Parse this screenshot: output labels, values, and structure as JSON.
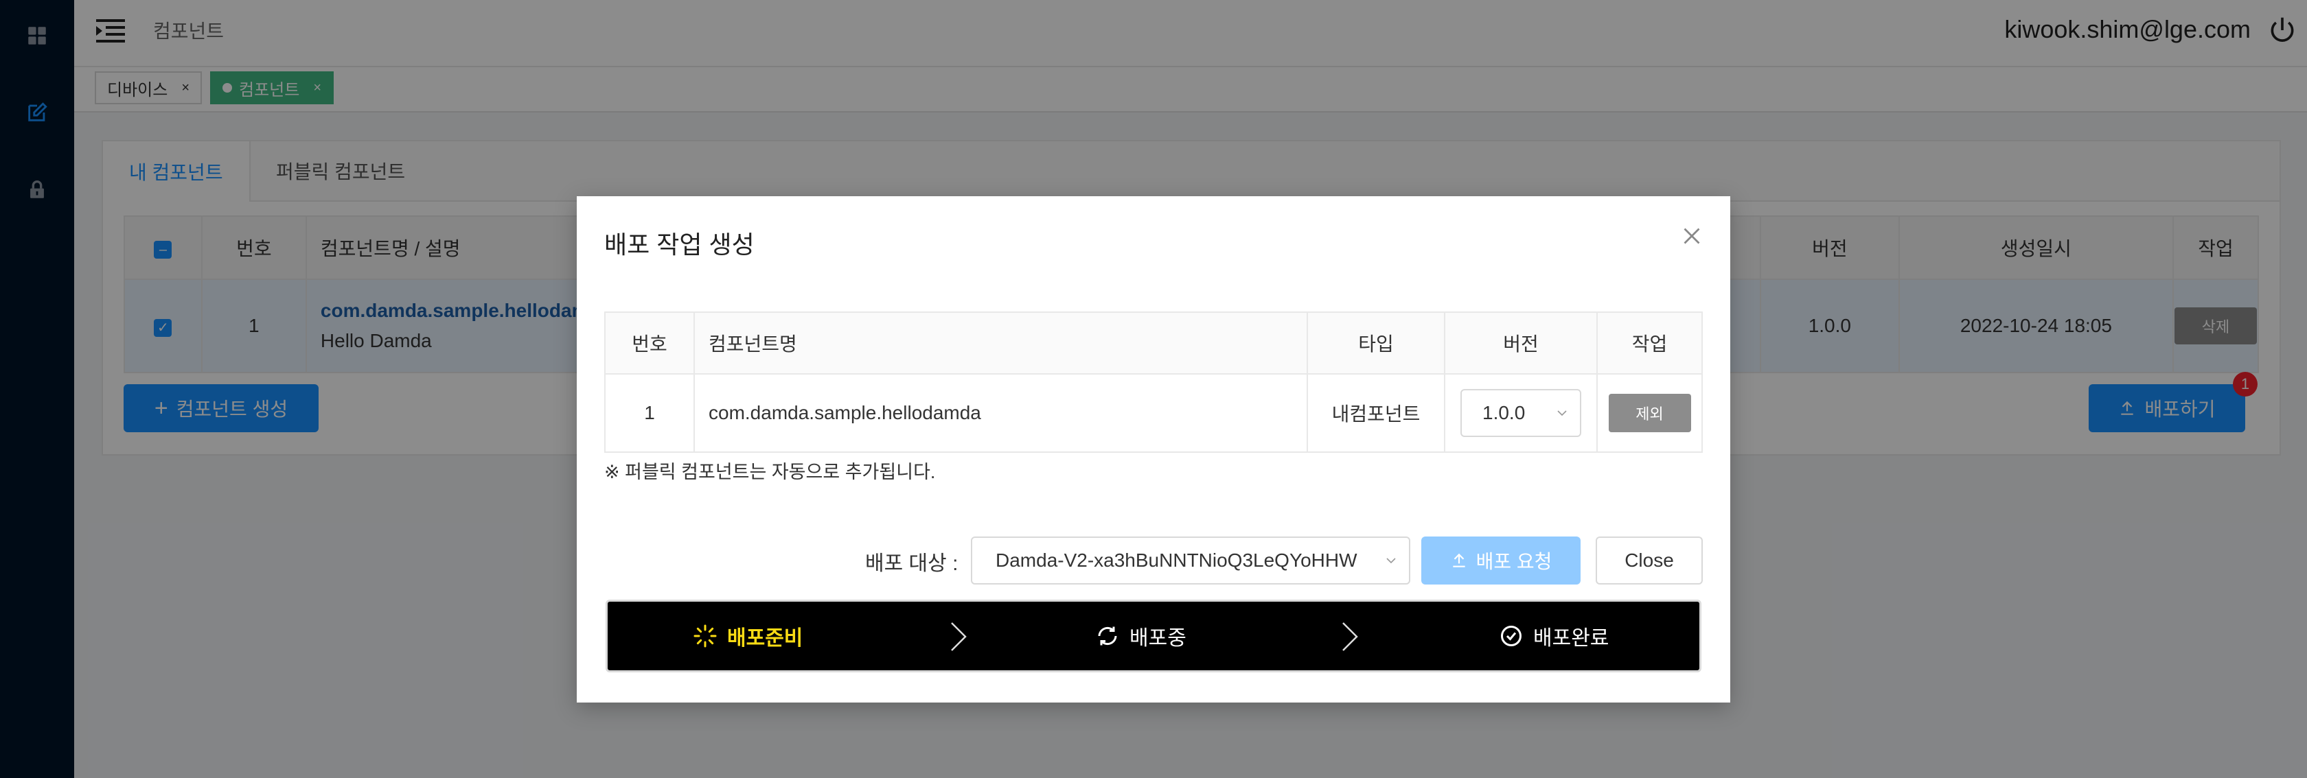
{
  "header": {
    "title": "컴포넌트",
    "user_email": "kiwook.shim@lge.com"
  },
  "page_tabs": [
    {
      "label": "디바이스",
      "close": "×"
    },
    {
      "label": "컴포넌트",
      "close": "×"
    }
  ],
  "content": {
    "tabs": [
      "내 컴포넌트",
      "퍼블릭 컴포넌트"
    ],
    "columns": [
      "번호",
      "컴포넌트명 / 설명",
      "버전",
      "생성일시",
      "작업"
    ],
    "rows": [
      {
        "no": "1",
        "name": "com.damda.sample.hellodamda",
        "desc": "Hello Damda",
        "version": "1.0.0",
        "created": "2022-10-24 18:05",
        "action": "삭제"
      }
    ],
    "create_button": "컴포넌트 생성",
    "deploy_button": "배포하기",
    "deploy_badge": "1"
  },
  "modal": {
    "title": "배포 작업 생성",
    "columns": [
      "번호",
      "컴포넌트명",
      "타입",
      "버전",
      "작업"
    ],
    "rows": [
      {
        "no": "1",
        "name": "com.damda.sample.hellodamda",
        "type": "내컴포넌트",
        "version": "1.0.0",
        "action": "제외"
      }
    ],
    "note": "※ 퍼블릭 컴포넌트는 자동으로 추가됩니다.",
    "target_label": "배포 대상 :",
    "target_value": "Damda-V2-xa3hBuNNTNioQ3LeQYoHHW",
    "request_button": "배포 요청",
    "close_button": "Close",
    "steps": [
      {
        "label": "배포준비",
        "state": "active"
      },
      {
        "label": "배포중",
        "state": "pending"
      },
      {
        "label": "배포완료",
        "state": "pending"
      }
    ]
  },
  "colors": {
    "sidebar": "#001529",
    "primary": "#1890ff",
    "active_tab": "#42b983",
    "step_active": "#fadb14",
    "badge": "#f5222d"
  }
}
